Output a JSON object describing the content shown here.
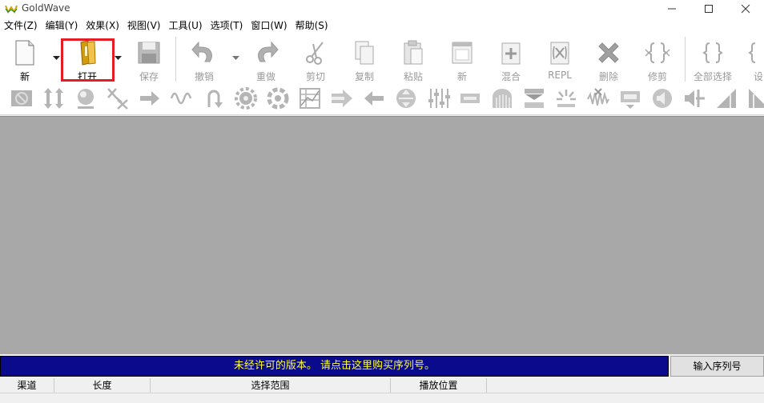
{
  "window": {
    "title": "GoldWave"
  },
  "menu": [
    "文件(Z)",
    "编辑(Y)",
    "效果(X)",
    "视图(V)",
    "工具(U)",
    "选项(T)",
    "窗口(W)",
    "帮助(S)"
  ],
  "toolbar": {
    "new": "新",
    "open": "打开",
    "save": "保存",
    "undo": "撤销",
    "redo": "重做",
    "cut": "剪切",
    "copy": "复制",
    "paste": "粘贴",
    "new2": "新",
    "mix": "混合",
    "repl": "REPL",
    "delete": "删除",
    "trim": "修剪",
    "select_all": "全部选择",
    "settings": "设"
  },
  "colors": {
    "highlight": "#e51c23",
    "license_bg": "#0a0a8c",
    "license_text": "#ffff33",
    "workspace": "#a8a8a8"
  },
  "license": {
    "message": "未经许可的版本。 请点击这里购买序列号。",
    "serial_button": "输入序列号"
  },
  "status": {
    "channel": "渠道",
    "length": "长度",
    "selection": "选择范围",
    "position": "播放位置"
  }
}
